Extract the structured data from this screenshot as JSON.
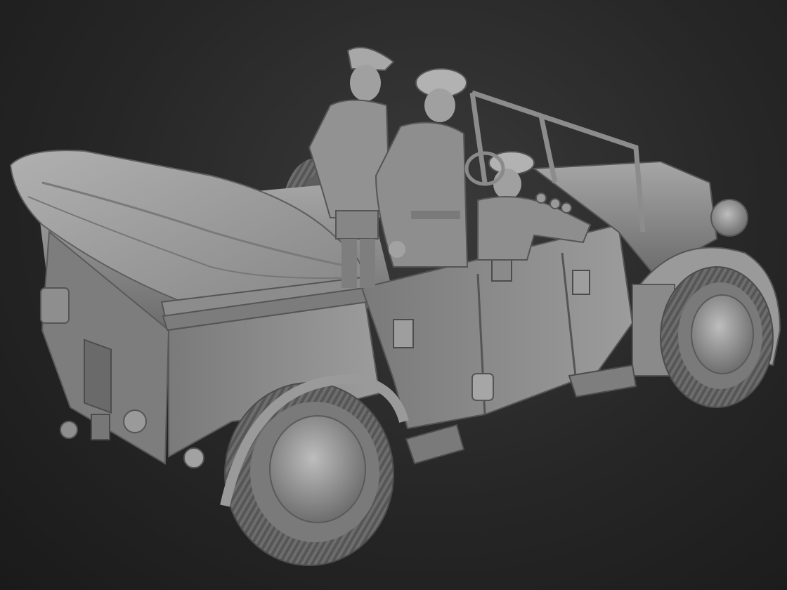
{
  "scene": {
    "subject_kind": "3D sculpt render of an open staff car with three uniformed figures",
    "palette": {
      "background": "#262626",
      "body": "#8a8a8a",
      "shadow": "#4a4a4a",
      "highlight": "#c4c4c4",
      "tire": "#6a6a6a"
    },
    "figures": [
      "standing-officer-cap",
      "standing-officer-peaked-cap",
      "seated-driver"
    ],
    "visible_text": []
  }
}
